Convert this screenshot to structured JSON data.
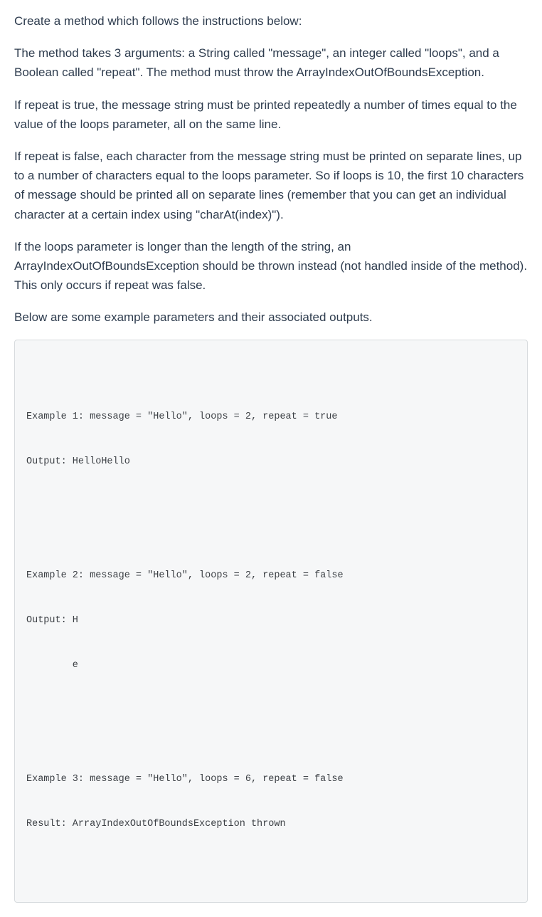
{
  "paragraphs": {
    "p0": "Create a method which follows the instructions below:",
    "p1": "The method takes 3 arguments: a String called \"message\", an integer called \"loops\", and a Boolean called \"repeat\". The method must throw the ArrayIndexOutOfBoundsException.",
    "p2": "If repeat is true, the message string must be printed repeatedly a number of times equal to the value of the loops parameter, all on the same line.",
    "p3": "If repeat is false, each character from the message string must be printed on separate lines, up to a number of characters equal to the loops parameter. So if loops is 10, the first 10 characters of message should be printed all on separate lines (remember that you can get an individual character at a certain index using \"charAt(index)\").",
    "p4": "If the loops parameter is longer than the length of the string, an ArrayIndexOutOfBoundsException should be thrown instead (not handled inside of the method). This only occurs if repeat was false.",
    "p5": "Below are some example parameters and their associated outputs."
  },
  "examples": {
    "ex1_l1": "Example 1: message = \"Hello\", loops = 2, repeat = true",
    "ex1_l2": "Output: HelloHello",
    "ex2_l1": "Example 2: message = \"Hello\", loops = 2, repeat = false",
    "ex2_l2": "Output: H",
    "ex2_l3": "        e",
    "ex3_l1": "Example 3: message = \"Hello\", loops = 6, repeat = false",
    "ex3_l2": "Result: ArrayIndexOutOfBoundsException thrown"
  }
}
